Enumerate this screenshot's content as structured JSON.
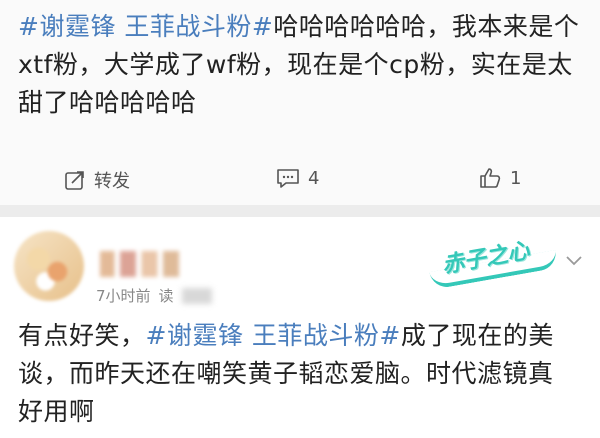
{
  "post": {
    "hashtag": "#谢霆锋 王菲战斗粉#",
    "text": "哈哈哈哈哈哈，我本来是个xtf粉，大学成了wf粉，现在是个cp粉，实在是太甜了哈哈哈哈哈",
    "actions": {
      "repost_label": "转发",
      "comment_count": "4",
      "like_count": "1"
    }
  },
  "comment": {
    "time_label": "7小时前",
    "read_label": "读",
    "badge_text": "赤子之心",
    "text_before": "有点好笑，",
    "hashtag": "#谢霆锋 王菲战斗粉#",
    "text_after": "成了现在的美谈，而昨天还在嘲笑黄子韬恋爱脑。时代滤镜真好用啊"
  },
  "colors": {
    "hashtag": "#4a7ebd",
    "text": "#222222",
    "meta": "#888888",
    "badge": "#34c8b8",
    "divider": "#ececec"
  },
  "icons": {
    "repost": "repost-icon",
    "comment": "comment-icon",
    "like": "like-icon",
    "chevron": "chevron-down-icon"
  }
}
